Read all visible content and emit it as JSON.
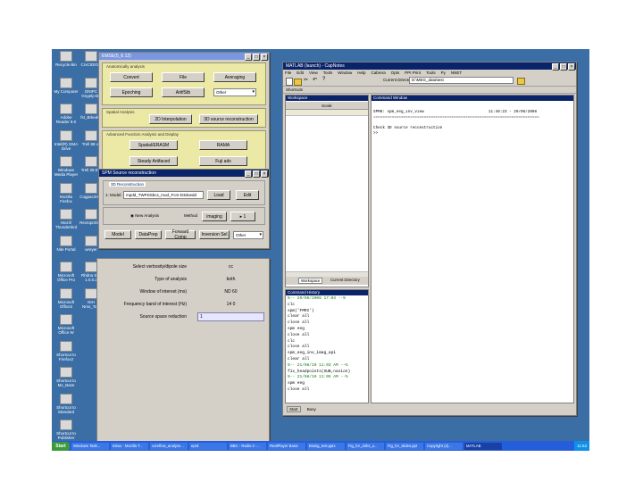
{
  "desktop_icons": [
    {
      "label": "Recycle Bin",
      "col": 0,
      "row": 0
    },
    {
      "label": "CrxCIDIObj",
      "col": 1,
      "row": 0
    },
    {
      "label": "My Computer",
      "col": 0,
      "row": 1
    },
    {
      "label": "DNIPC Gngelp-Bo",
      "col": 1,
      "row": 1
    },
    {
      "label": "Adobe Reader 9.0",
      "col": 0,
      "row": 2
    },
    {
      "label": "fst_BrkedCt",
      "col": 1,
      "row": 2
    },
    {
      "label": "Intel(R) GMA Drive",
      "col": 0,
      "row": 3
    },
    {
      "label": "Trell 88 vs",
      "col": 1,
      "row": 3
    },
    {
      "label": "Windows Media Player",
      "col": 0,
      "row": 4
    },
    {
      "label": "Trell 28 Ets",
      "col": 1,
      "row": 4
    },
    {
      "label": "Mozilla Firefox",
      "col": 0,
      "row": 5
    },
    {
      "label": "Cogpac2003",
      "col": 1,
      "row": 5
    },
    {
      "label": "Mozill Thunderbird",
      "col": 0,
      "row": 6
    },
    {
      "label": "Rectopr2005",
      "col": 1,
      "row": 6
    },
    {
      "label": "Nite Portal",
      "col": 0,
      "row": 7
    },
    {
      "label": "wreyer",
      "col": 1,
      "row": 7
    },
    {
      "label": "Microsoft Office Pro",
      "col": 0,
      "row": 8
    },
    {
      "label": "Rhdna Sch 1.0.0.2",
      "col": 1,
      "row": 8
    },
    {
      "label": "Microsoft Office2",
      "col": 0,
      "row": 9
    },
    {
      "label": "NIH Nms_Tool",
      "col": 1,
      "row": 9
    },
    {
      "label": "Microsoft Office W",
      "col": 0,
      "row": 10
    },
    {
      "label": "Shortcut to Firefox2",
      "col": 0,
      "row": 11
    },
    {
      "label": "Shortcut to Mx_Base",
      "col": 0,
      "row": 12
    },
    {
      "label": "Shortcut to Standard",
      "col": 0,
      "row": 13
    },
    {
      "label": "Shortcut to Publisher",
      "col": 0,
      "row": 14
    }
  ],
  "launcher": {
    "title": "EMSE(5_6.12)",
    "section1_title": "Anatomically analysis",
    "buttons1": [
      "Convert",
      "File",
      "Averaging",
      "Epoching",
      "ArtifStb"
    ],
    "select1": "Other",
    "section2_title": "Spatial Analysis",
    "buttons2": [
      "2D Interpolation",
      "3D source reconstruction"
    ],
    "section3_title": "Advanced Function Analysis and Display",
    "buttons3": [
      "Spatial/ERASM",
      "RAMA",
      "Steady Artifaced",
      "Fuji ads"
    ]
  },
  "sr_window": {
    "title": "SPM Source reconstruction",
    "panel_title": "3D Reconstruction",
    "file_label": "1: Model:",
    "file_value": "mpdd_TWFDSbcs_mod_Fcm-D3doedd",
    "load_label": "Load",
    "edit_label": "Edit",
    "new_analysis": "New Analysis",
    "method_label": "Method",
    "method_value": "imaging",
    "next_label": "▸ 1",
    "bottom_buttons": [
      "Model",
      "DataPrep",
      "Forward Comp",
      "Inversion Sel"
    ],
    "bottom_select": "Other"
  },
  "props_window": {
    "rows": [
      {
        "label": "Select verbosity/dipole size",
        "value": "cc"
      },
      {
        "label": "Type of analysis",
        "value": "both"
      },
      {
        "label": "Window of interest (ms)",
        "value": "ND 60"
      },
      {
        "label": "Frequency band of interest (Hz)",
        "value": "14 0"
      },
      {
        "label": "Source space reduction",
        "value": "1"
      }
    ]
  },
  "matlab": {
    "title": "MATLAB (launch) - CapNotes",
    "menu": [
      "File",
      "Edit",
      "View",
      "Tools",
      "Window",
      "Help",
      "Cabrera",
      "Opts",
      "PPI Print",
      "Tools",
      "Py",
      "NNET"
    ],
    "shortcuts_label": "Shortcuts",
    "current_dir_label": "Current Directory:",
    "current_dir_value": "D:\\MEG_data\\test",
    "workspace_title": "Workspace",
    "scale_label": "Scale:",
    "workspace_tabs": [
      "Workspace",
      "Current Directory"
    ],
    "history_title": "Command History",
    "history_lines": [
      "%-- 29/05/2008 17:03 --%",
      "clc",
      "spm('FMRI')",
      "clear all",
      "close all",
      "spm eeg",
      "close all",
      "clc",
      "close all",
      "spm_eeg_inv_imag_api",
      "clear all",
      "%-- 21/08/10 11:03 AM --%",
      "fix_headpoints(SUB,nasion)",
      "%-- 21/08/10 11:05 AM --%",
      "spm eeg",
      "close all"
    ],
    "cmd_title": "Command Window",
    "cmd_lines": [
      "SPM8: spm_eeg_inv_view                            11:48:23 - 29/05/2008",
      "========================================================================",
      "",
      "Check 3D source reconstruction",
      ">>"
    ],
    "start_label": "Start",
    "busy_label": "Busy"
  },
  "taskbar": {
    "start_label": "Start",
    "tasks": [
      "Windows Task...",
      "Inbox - Mozilla T...",
      "coreflow_analyze...",
      "eprd",
      "BBC - Radio 3 -...",
      "RealPlayer Basic",
      "Biosig_test.pptx",
      "Fig_for_dohs_u...",
      "Fig_for_slides.ppt",
      "Copyright (2)...",
      "MATLAB"
    ],
    "active_index": 10,
    "clock": "11:53"
  }
}
